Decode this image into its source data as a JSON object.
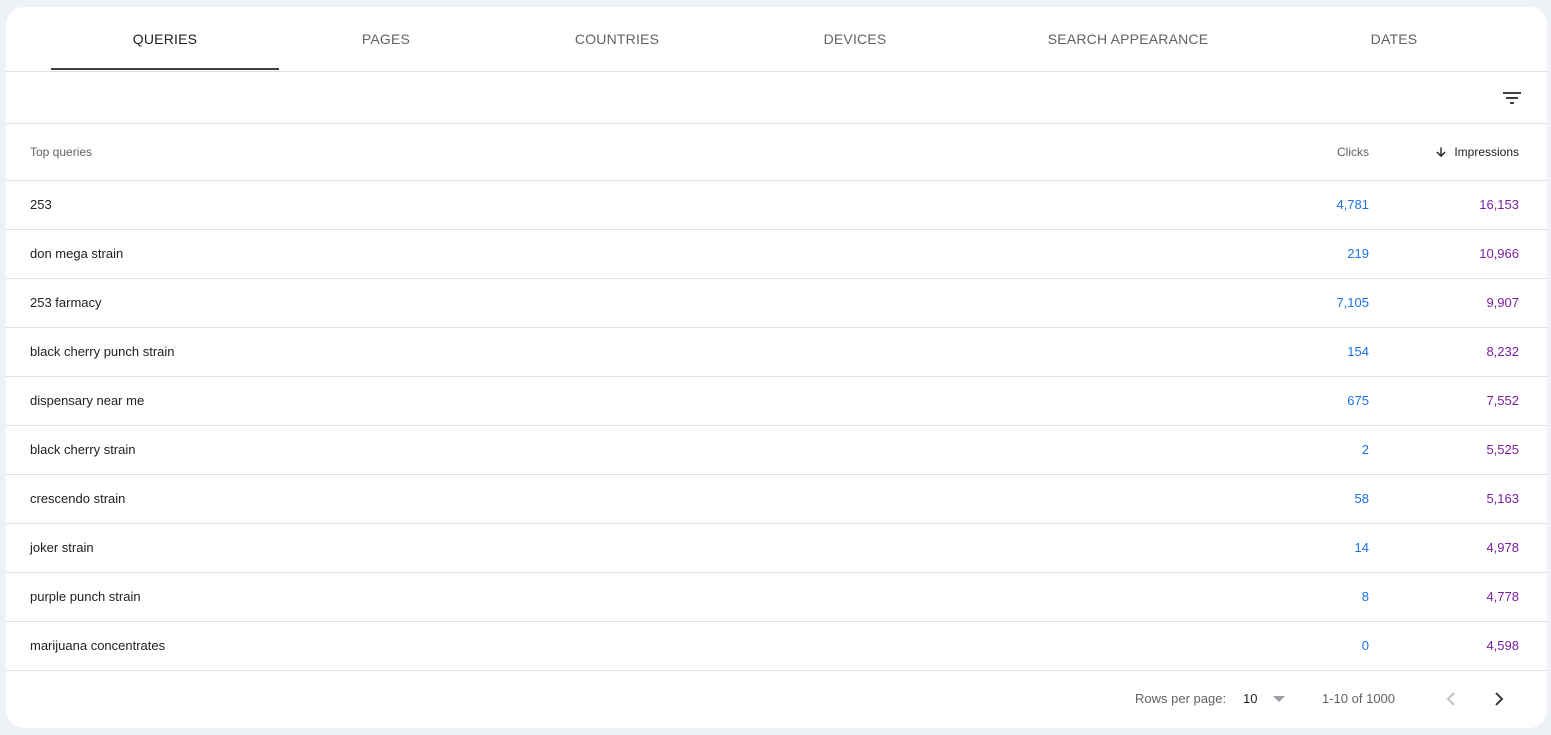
{
  "tabs": [
    {
      "label": "QUERIES",
      "active": true
    },
    {
      "label": "PAGES",
      "active": false
    },
    {
      "label": "COUNTRIES",
      "active": false
    },
    {
      "label": "DEVICES",
      "active": false
    },
    {
      "label": "SEARCH APPEARANCE",
      "active": false
    },
    {
      "label": "DATES",
      "active": false
    }
  ],
  "filter": {
    "icon": "filter-list-icon"
  },
  "table": {
    "headers": {
      "query": "Top queries",
      "clicks": "Clicks",
      "impressions": "Impressions",
      "sort_icon": "arrow-down-icon"
    },
    "rows": [
      {
        "query": "253",
        "clicks": "4,781",
        "impressions": "16,153"
      },
      {
        "query": "don mega strain",
        "clicks": "219",
        "impressions": "10,966"
      },
      {
        "query": "253 farmacy",
        "clicks": "7,105",
        "impressions": "9,907"
      },
      {
        "query": "black cherry punch strain",
        "clicks": "154",
        "impressions": "8,232"
      },
      {
        "query": "dispensary near me",
        "clicks": "675",
        "impressions": "7,552"
      },
      {
        "query": "black cherry strain",
        "clicks": "2",
        "impressions": "5,525"
      },
      {
        "query": "crescendo strain",
        "clicks": "58",
        "impressions": "5,163"
      },
      {
        "query": "joker strain",
        "clicks": "14",
        "impressions": "4,978"
      },
      {
        "query": "purple punch strain",
        "clicks": "8",
        "impressions": "4,778"
      },
      {
        "query": "marijuana concentrates",
        "clicks": "0",
        "impressions": "4,598"
      }
    ]
  },
  "pagination": {
    "rows_per_page_label": "Rows per page:",
    "rows_per_page_value": "10",
    "range": "1-10 of 1000"
  },
  "colors": {
    "clicks": "#1a73e8",
    "impressions": "#7b1fa2",
    "background": "#eef1f5"
  }
}
